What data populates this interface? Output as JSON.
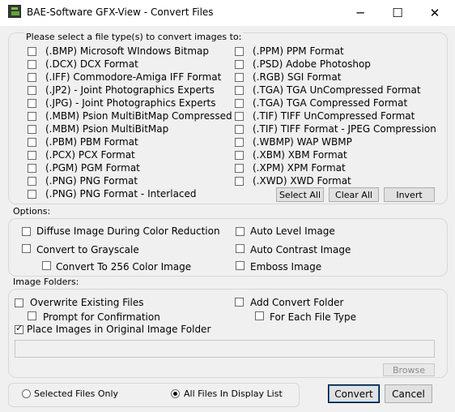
{
  "window": {
    "title": "BAE-Software GFX-View - Convert Files",
    "min_glyph": "─",
    "max_glyph": "☐",
    "close_glyph": "✕"
  },
  "file_types": {
    "legend": "Please select a file type(s) to convert images to:",
    "left": [
      {
        "label": "(.BMP) Microsoft WIndows Bitmap",
        "checked": false
      },
      {
        "label": "(.DCX) DCX Format",
        "checked": false
      },
      {
        "label": "(.IFF) Commodore-Amiga IFF Format",
        "checked": false
      },
      {
        "label": "(.JP2) - Joint Photographics Experts",
        "checked": false
      },
      {
        "label": "(.JPG) - Joint Photographics Experts",
        "checked": false
      },
      {
        "label": "(.MBM) Psion MultiBitMap Compressed",
        "checked": false
      },
      {
        "label": "(.MBM) Psion MultiBitMap",
        "checked": false
      },
      {
        "label": "(.PBM) PBM Format",
        "checked": false
      },
      {
        "label": "(.PCX) PCX Format",
        "checked": false
      },
      {
        "label": "(.PGM) PGM Format",
        "checked": false
      },
      {
        "label": "(.PNG) PNG Format",
        "checked": false
      },
      {
        "label": "(.PNG) PNG Format  - Interlaced",
        "checked": false
      }
    ],
    "right": [
      {
        "label": "(.PPM) PPM Format",
        "checked": false
      },
      {
        "label": "(.PSD) Adobe Photoshop",
        "checked": false
      },
      {
        "label": "(.RGB) SGI Format",
        "checked": false
      },
      {
        "label": "(.TGA) TGA UnCompressed Format",
        "checked": false
      },
      {
        "label": "(.TGA) TGA Compressed Format",
        "checked": false
      },
      {
        "label": "(.TIF) TIFF UnCompressed Format",
        "checked": false
      },
      {
        "label": "(.TIF) TIFF Format - JPEG Compression",
        "checked": false
      },
      {
        "label": "(.WBMP) WAP WBMP",
        "checked": false
      },
      {
        "label": "(.XBM) XBM Format",
        "checked": false
      },
      {
        "label": "(.XPM) XPM Format",
        "checked": false
      },
      {
        "label": "(.XWD) XWD Format",
        "checked": false
      }
    ],
    "select_all": "Select All",
    "clear_all": "Clear All",
    "invert": "Invert"
  },
  "options": {
    "legend": "Options:",
    "diffuse": "Diffuse Image During Color Reduction",
    "grayscale": "Convert to Grayscale",
    "color256": "Convert To 256 Color Image",
    "auto_level": "Auto Level Image",
    "auto_contrast": "Auto Contrast Image",
    "emboss": "Emboss Image"
  },
  "folders": {
    "legend": "Image Folders:",
    "overwrite": "Overwrite Existing Files",
    "prompt": "Prompt for Confirmation",
    "place_original": "Place Images in Original Image Folder",
    "place_original_checked": true,
    "add_convert": "Add Convert Folder",
    "each_type": "For Each File Type",
    "path_value": "",
    "browse": "Browse"
  },
  "scope": {
    "selected": "Selected Files Only",
    "all": "All Files In Display List",
    "selected_value": "all"
  },
  "buttons": {
    "convert": "Convert",
    "cancel": "Cancel"
  }
}
